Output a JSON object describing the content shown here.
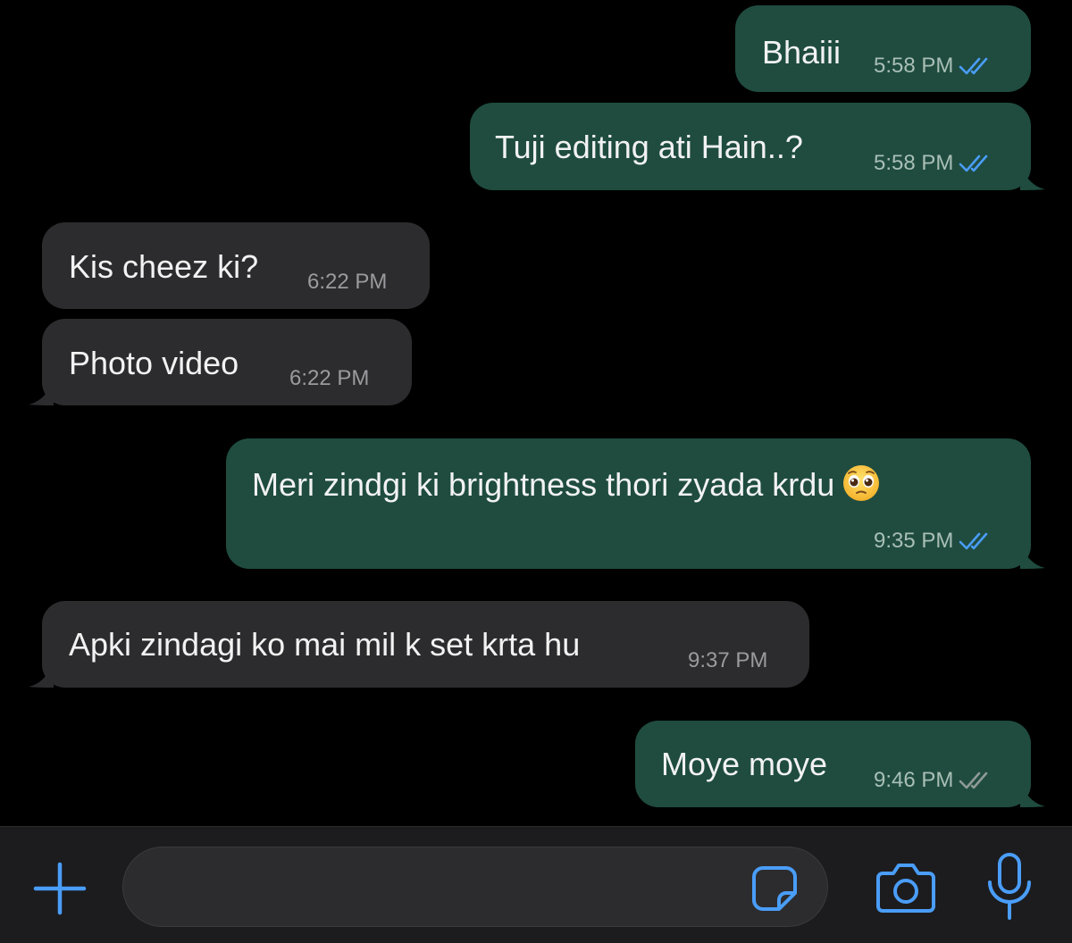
{
  "messages": [
    {
      "direction": "outgoing",
      "text": "Bhaiii",
      "time": "5:58 PM",
      "status": "read"
    },
    {
      "direction": "outgoing",
      "text": "Tuji editing ati Hain..?",
      "time": "5:58 PM",
      "status": "read"
    },
    {
      "direction": "incoming",
      "text": "Kis cheez ki?",
      "time": "6:22 PM"
    },
    {
      "direction": "incoming",
      "text": "Photo video",
      "time": "6:22 PM"
    },
    {
      "direction": "outgoing",
      "text": "Meri zindgi ki brightness thori zyada krdu",
      "emoji": "pleading-face",
      "time": "9:35 PM",
      "status": "read"
    },
    {
      "direction": "incoming",
      "text": "Apki zindagi ko mai mil k set krta hu",
      "time": "9:37 PM"
    },
    {
      "direction": "outgoing",
      "text": "Moye moye",
      "time": "9:46 PM",
      "status": "delivered"
    }
  ],
  "composer": {
    "placeholder": "",
    "icons": [
      "plus-icon",
      "sticker-icon",
      "camera-icon",
      "microphone-icon"
    ]
  },
  "colors": {
    "background": "#000000",
    "outgoing_bubble": "#1f4c3f",
    "incoming_bubble": "#2c2c2e",
    "accent": "#4a9df8",
    "read_ticks": "#4a9df8",
    "delivered_ticks": "#8e9a95"
  }
}
